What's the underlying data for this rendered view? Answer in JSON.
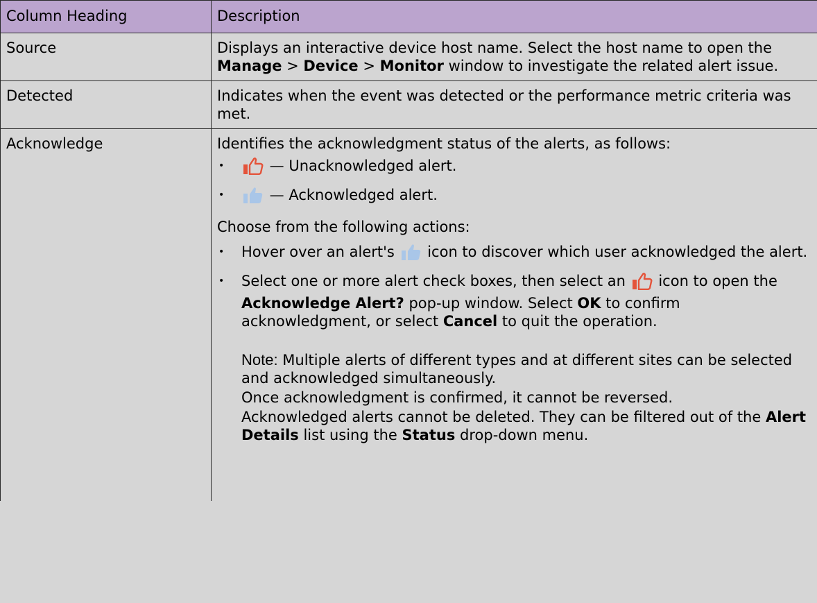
{
  "table": {
    "headers": [
      "Column Heading",
      "Description"
    ],
    "rows": {
      "source": {
        "heading": "Source",
        "desc": {
          "t1": "Displays an interactive device host name. Select the host name to open the ",
          "b1": "Manage",
          "t2": " > ",
          "b2": "Device",
          "t3": " > ",
          "b3": "Monitor",
          "t4": " window to investigate the related alert issue."
        }
      },
      "detected": {
        "heading": "Detected",
        "desc": "Indicates when the event was detected or the performance metric criteria was met."
      },
      "acknowledge": {
        "heading": "Acknowledge",
        "intro": "Identifies the acknowledgment status of the alerts, as follows:",
        "status": [
          {
            "icon": "thumbs-up-outline-icon",
            "text": " — Unacknowledged alert."
          },
          {
            "icon": "thumbs-up-filled-icon",
            "text": " — Acknowledged alert."
          }
        ],
        "actions_intro": "Choose from the following actions:",
        "action1": {
          "t1": "Hover over an alert's ",
          "t2": " icon to discover which user acknowledged the alert."
        },
        "action2": {
          "t1": "Select one or more alert check boxes, then select an ",
          "t2": " icon to open the ",
          "b1": "Acknowledge Alert?",
          "t3": " pop-up window. Select ",
          "b2": "OK",
          "t4": " to confirm acknowledgment, or select ",
          "b3": "Cancel",
          "t5": " to quit the operation."
        },
        "note": {
          "label": "Note:",
          "line1": " Multiple alerts of different types and at different sites can be selected and acknowledged simultaneously.",
          "line2": "Once acknowledgment is confirmed, it cannot be reversed.",
          "line3": {
            "t1": "Acknowledged alerts cannot be deleted. They can be filtered out of the ",
            "b1": "Alert Details",
            "t2": " list using the ",
            "b2": "Status",
            "t3": " drop-down menu."
          }
        }
      }
    }
  },
  "colors": {
    "header_bg": "#bba4ce",
    "body_bg": "#d6d6d6",
    "icon_outline": "#e4533a",
    "icon_filled": "#a9c6e8"
  }
}
